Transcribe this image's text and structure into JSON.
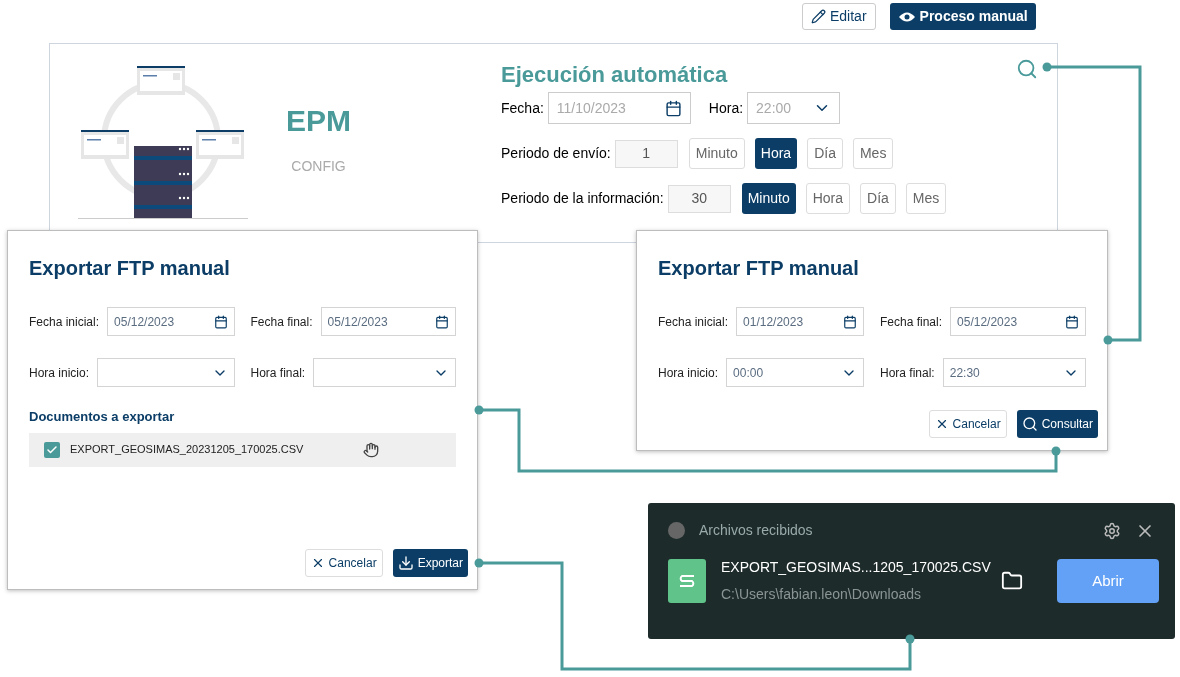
{
  "toolbar": {
    "buttons": [
      {
        "label": "Editar",
        "kind": "outline"
      },
      {
        "label": "Proceso manual",
        "kind": "primary"
      }
    ]
  },
  "config_panel": {
    "name": "EPM",
    "subtitle": "CONFIG",
    "auto_execution": {
      "title": "Ejecución automática",
      "date_label": "Fecha:",
      "date_value": "11/10/2023",
      "time_label": "Hora:",
      "time_value": "22:00",
      "periods": [
        {
          "label": "Periodo de envío:",
          "value": "1",
          "units": [
            {
              "label": "Minuto",
              "selected": false
            },
            {
              "label": "Hora",
              "selected": true
            },
            {
              "label": "Día",
              "selected": false
            },
            {
              "label": "Mes",
              "selected": false
            }
          ]
        },
        {
          "label": "Periodo de la información:",
          "value": "30",
          "units": [
            {
              "label": "Minuto",
              "selected": true
            },
            {
              "label": "Hora",
              "selected": false
            },
            {
              "label": "Día",
              "selected": false
            },
            {
              "label": "Mes",
              "selected": false
            }
          ]
        }
      ]
    }
  },
  "export_dialogs": [
    {
      "title": "Exportar FTP manual",
      "fields": [
        {
          "label": "Fecha inicial:",
          "kind": "date",
          "value": "05/12/2023"
        },
        {
          "label": "Fecha final:",
          "kind": "date",
          "value": "05/12/2023"
        },
        {
          "label": "Hora inicio:",
          "kind": "select"
        },
        {
          "label": "Hora final:",
          "kind": "select"
        }
      ],
      "documents_title": "Documentos a exportar",
      "documents": [
        {
          "name": "EXPORT_GEOSIMAS_20231205_170025.CSV",
          "checked": true
        }
      ],
      "buttons": [
        {
          "label": "Cancelar",
          "kind": "cancel"
        },
        {
          "label": "Exportar",
          "kind": "export"
        }
      ]
    },
    {
      "title": "Exportar FTP manual",
      "fields": [
        {
          "label": "Fecha inicial:",
          "kind": "date",
          "value": "01/12/2023"
        },
        {
          "label": "Fecha final:",
          "kind": "date",
          "value": "05/12/2023"
        },
        {
          "label": "Hora inicio:",
          "kind": "select",
          "value": "00:00"
        },
        {
          "label": "Hora final:",
          "kind": "select",
          "value": "22:30"
        }
      ],
      "buttons": [
        {
          "label": "Cancelar",
          "kind": "cancel"
        },
        {
          "label": "Consultar",
          "kind": "search"
        }
      ]
    }
  ],
  "notification": {
    "title": "Archivos recibidos",
    "file_name": "EXPORT_GEOSIMAS...1205_170025.CSV",
    "path": "C:\\Users\\fabian.leon\\Downloads",
    "button": "Abrir"
  }
}
